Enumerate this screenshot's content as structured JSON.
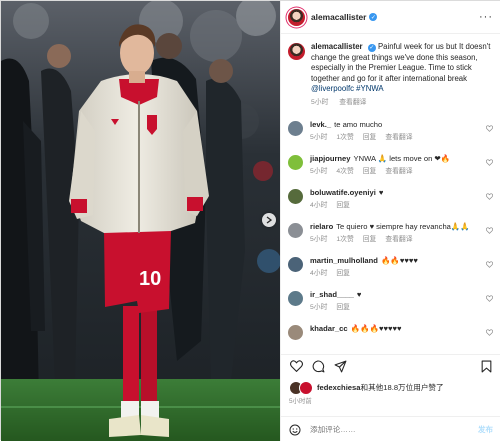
{
  "photo": {
    "alt_icon": "post-photo",
    "jersey_number": "10",
    "colors": {
      "jacket": "#e6e3d8",
      "shorts": "#c8102e",
      "pitch": "#2f6e2e",
      "crowd": "#252b30"
    }
  },
  "header": {
    "username": "alemacallister",
    "verified_icon": "verified-badge-icon"
  },
  "caption": {
    "username": "alemacallister",
    "text": "Painful week for us but It doesn't change the great things we've done this season, especially in the Premier League. Time to stick together and go for it after international break",
    "tags": "@liverpoolfc #YNWA",
    "time": "5小时",
    "translate": "查看翻译"
  },
  "comments": [
    {
      "username": "levk._",
      "text": "te amo mucho",
      "time": "5小时",
      "likes": "1次赞",
      "reply": "回复",
      "translate": "查看翻译",
      "avatar_color": "#6d7f8f"
    },
    {
      "username": "jiapjourney",
      "text": "YNWA 🙏 lets move on ❤🔥",
      "time": "5小时",
      "likes": "4次赞",
      "reply": "回复",
      "translate": "查看翻译",
      "avatar_color": "#7fbf3a"
    },
    {
      "username": "boluwatife.oyeniyi",
      "text": "♥",
      "time": "4小时",
      "likes": "",
      "reply": "回复",
      "translate": "",
      "avatar_color": "#566b3c"
    },
    {
      "username": "rielaro",
      "text": "Te quiero ♥ siempre hay revancha🙏🙏",
      "time": "5小时",
      "likes": "1次赞",
      "reply": "回复",
      "translate": "查看翻译",
      "avatar_color": "#8b8f95"
    },
    {
      "username": "martin_mulholland",
      "text": "🔥🔥♥♥♥♥",
      "time": "4小时",
      "likes": "",
      "reply": "回复",
      "translate": "",
      "avatar_color": "#4b6378"
    },
    {
      "username": "ir_shad____",
      "text": "♥",
      "time": "5小时",
      "likes": "",
      "reply": "回复",
      "translate": "",
      "avatar_color": "#5d7a8a"
    },
    {
      "username": "khadar_cc",
      "text": "🔥🔥🔥♥♥♥♥♥",
      "time": "",
      "likes": "",
      "reply": "",
      "translate": "",
      "avatar_color": "#9a8a7a"
    }
  ],
  "likes": {
    "user": "fedexchiesa",
    "text": "和其他18.8万位用户赞了",
    "time": "5小时前"
  },
  "add_comment": {
    "placeholder": "添加评论……",
    "post_label": "发布"
  }
}
